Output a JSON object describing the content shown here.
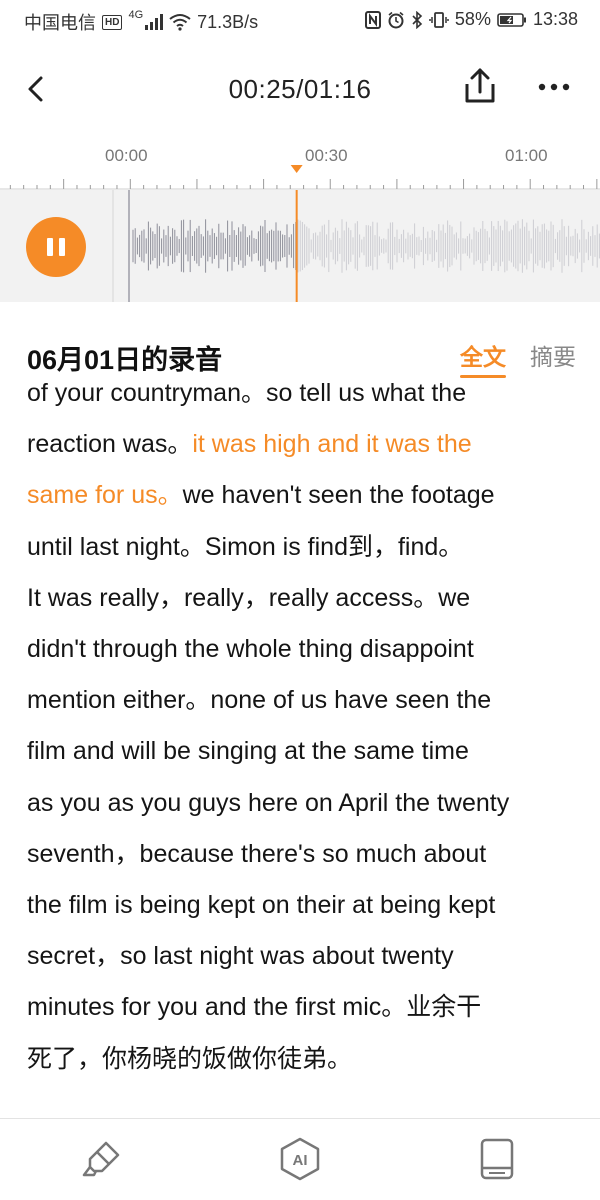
{
  "status_bar": {
    "carrier": "中国电信",
    "hd": "HD",
    "network": "4G",
    "speed": "71.3B/s",
    "battery": "58%",
    "time": "13:38"
  },
  "header": {
    "time_display": "00:25/01:16",
    "back_icon": "chevron-left-icon",
    "share_icon": "share-icon",
    "more_icon": "more-icon"
  },
  "timeline": {
    "tick_labels": [
      "00:00",
      "00:30",
      "01:00"
    ],
    "current_seconds": 25,
    "total_seconds": 76,
    "accent_color": "#f58b27",
    "state": "playing",
    "pause_icon": "pause-icon"
  },
  "recording": {
    "title": "06月01日的录音",
    "tabs": [
      {
        "label": "全文",
        "active": true
      },
      {
        "label": "摘要",
        "active": false
      }
    ]
  },
  "transcript": {
    "lines": [
      [
        {
          "text": "of your countryman。so tell us what the"
        }
      ],
      [
        {
          "text": "reaction was。"
        },
        {
          "text": "it was high and it was the",
          "highlight": true
        }
      ],
      [
        {
          "text": "same for us。",
          "highlight": true
        },
        {
          "text": "we haven't seen the footage"
        }
      ],
      [
        {
          "text": "until last night。Simon is find到，find。"
        }
      ],
      [
        {
          "text": "It was really，really，really access。we"
        }
      ],
      [
        {
          "text": "didn't through the whole thing disappoint"
        }
      ],
      [
        {
          "text": "mention either。none of us have seen the"
        }
      ],
      [
        {
          "text": "film and will be singing at the same time"
        }
      ],
      [
        {
          "text": "as you as you guys here on April the twenty"
        }
      ],
      [
        {
          "text": "seventh，because there's so much about"
        }
      ],
      [
        {
          "text": "the film is being kept on their at being kept"
        }
      ],
      [
        {
          "text": "secret，so last night was about twenty"
        }
      ],
      [
        {
          "text": "minutes for you and the first mic。业余干"
        }
      ],
      [
        {
          "text": "死了，你杨晓的饭做你徒弟。"
        }
      ]
    ]
  },
  "bottom_bar": {
    "items": [
      {
        "icon": "highlighter-icon"
      },
      {
        "icon": "ai-icon",
        "label": "AI"
      },
      {
        "icon": "book-icon"
      }
    ]
  }
}
